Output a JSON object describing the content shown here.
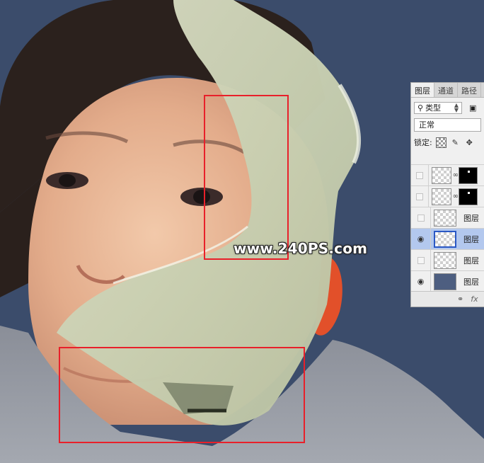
{
  "watermark": {
    "text": "www.240PS.com"
  },
  "layers_panel": {
    "tabs": [
      {
        "label": "图层"
      },
      {
        "label": "通道"
      },
      {
        "label": "路径"
      }
    ],
    "filter": {
      "icon": "search-icon",
      "label": "类型"
    },
    "blend_mode": "正常",
    "lock_label": "锁定:",
    "layers": [
      {
        "name": "",
        "visible": false,
        "has_mask": true
      },
      {
        "name": "",
        "visible": false,
        "has_mask": true
      },
      {
        "name": "图层",
        "visible": false,
        "has_mask": false
      },
      {
        "name": "图层",
        "visible": true,
        "has_mask": false,
        "selected": true
      },
      {
        "name": "图层",
        "visible": false,
        "has_mask": false
      },
      {
        "name": "图层",
        "visible": true,
        "has_mask": false,
        "photo": true
      }
    ],
    "footer": {
      "link_icon": "link-icon",
      "fx_label": "fx"
    }
  },
  "colors": {
    "background": "#3b4c6b",
    "selection_rect": "#e8202a",
    "panel_bg": "#f0f0f0",
    "selected_layer": "#b3c8ee"
  }
}
